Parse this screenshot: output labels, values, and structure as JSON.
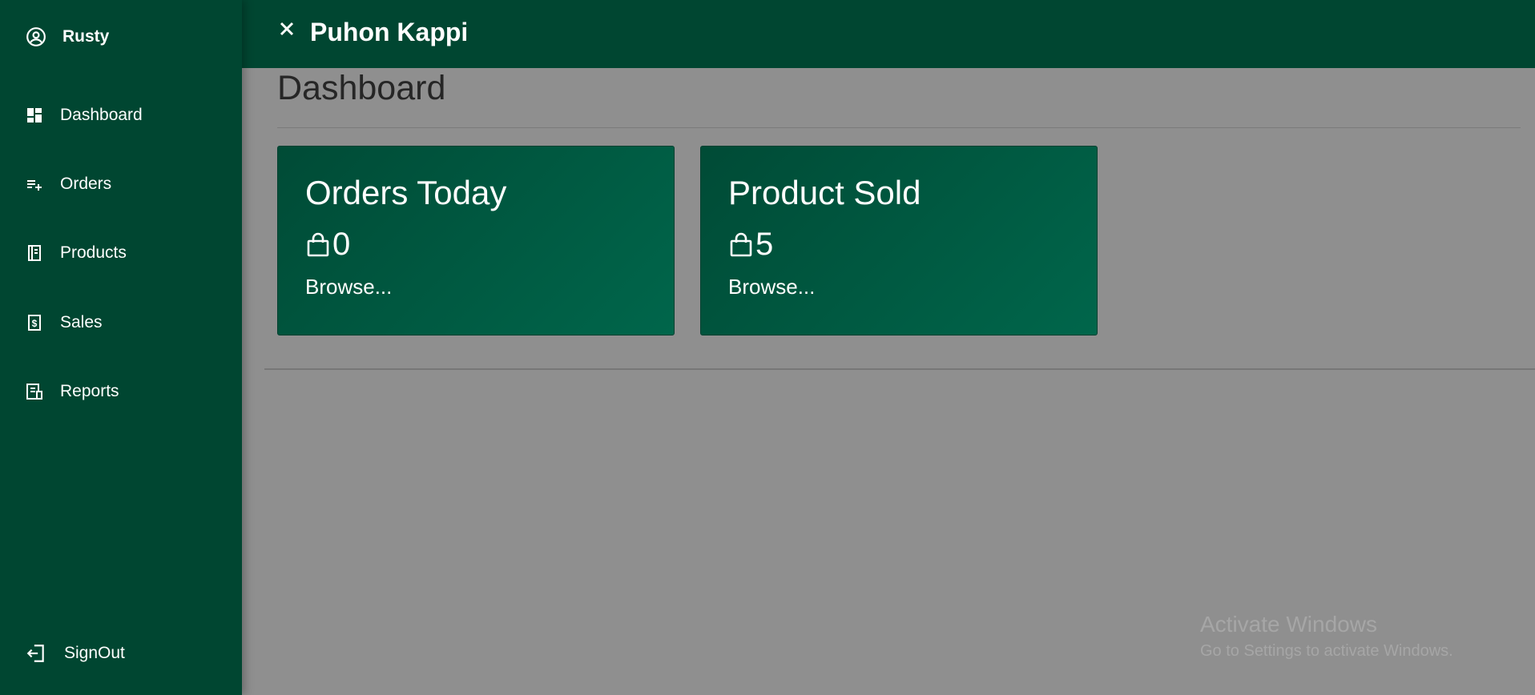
{
  "sidebar": {
    "user": {
      "name": "Rusty",
      "icon": "user-circle-icon"
    },
    "items": [
      {
        "label": "Dashboard",
        "icon": "dashboard-icon"
      },
      {
        "label": "Orders",
        "icon": "playlist-add-icon"
      },
      {
        "label": "Products",
        "icon": "book-icon"
      },
      {
        "label": "Sales",
        "icon": "receipt-dollar-icon"
      },
      {
        "label": "Reports",
        "icon": "report-icon"
      }
    ],
    "signout": {
      "label": "SignOut",
      "icon": "signout-icon"
    }
  },
  "topbar": {
    "close_icon": "close-icon",
    "title": "Puhon Kappi"
  },
  "main": {
    "title": "Dashboard",
    "cards": [
      {
        "title": "Orders Today",
        "count": "0",
        "icon": "shopping-bag-icon",
        "link": "Browse..."
      },
      {
        "title": "Product Sold",
        "count": "5",
        "icon": "shopping-bag-icon",
        "link": "Browse..."
      }
    ]
  },
  "watermark": {
    "title": "Activate Windows",
    "subtitle": "Go to Settings to activate Windows."
  },
  "colors": {
    "sidebar": "#004631",
    "overlay": "#8f8f8f",
    "card_start": "#004b36",
    "card_end": "#00664b"
  }
}
